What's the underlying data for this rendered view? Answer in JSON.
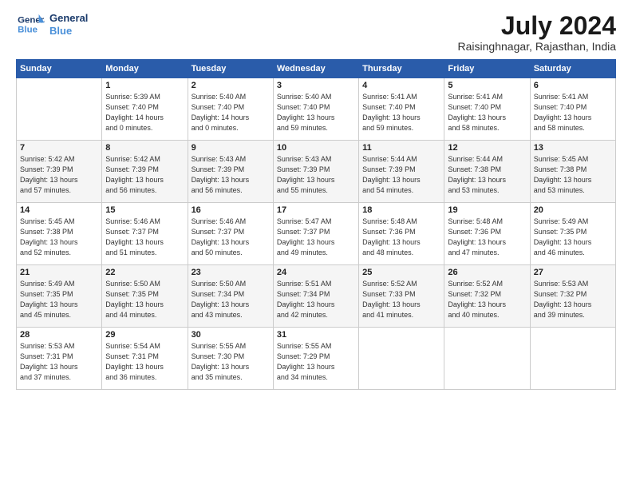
{
  "header": {
    "logo_line1": "General",
    "logo_line2": "Blue",
    "month_year": "July 2024",
    "location": "Raisinghnagar, Rajasthan, India"
  },
  "days_of_week": [
    "Sunday",
    "Monday",
    "Tuesday",
    "Wednesday",
    "Thursday",
    "Friday",
    "Saturday"
  ],
  "weeks": [
    [
      {
        "day": "",
        "info": ""
      },
      {
        "day": "1",
        "info": "Sunrise: 5:39 AM\nSunset: 7:40 PM\nDaylight: 14 hours\nand 0 minutes."
      },
      {
        "day": "2",
        "info": "Sunrise: 5:40 AM\nSunset: 7:40 PM\nDaylight: 14 hours\nand 0 minutes."
      },
      {
        "day": "3",
        "info": "Sunrise: 5:40 AM\nSunset: 7:40 PM\nDaylight: 13 hours\nand 59 minutes."
      },
      {
        "day": "4",
        "info": "Sunrise: 5:41 AM\nSunset: 7:40 PM\nDaylight: 13 hours\nand 59 minutes."
      },
      {
        "day": "5",
        "info": "Sunrise: 5:41 AM\nSunset: 7:40 PM\nDaylight: 13 hours\nand 58 minutes."
      },
      {
        "day": "6",
        "info": "Sunrise: 5:41 AM\nSunset: 7:40 PM\nDaylight: 13 hours\nand 58 minutes."
      }
    ],
    [
      {
        "day": "7",
        "info": "Sunrise: 5:42 AM\nSunset: 7:39 PM\nDaylight: 13 hours\nand 57 minutes."
      },
      {
        "day": "8",
        "info": "Sunrise: 5:42 AM\nSunset: 7:39 PM\nDaylight: 13 hours\nand 56 minutes."
      },
      {
        "day": "9",
        "info": "Sunrise: 5:43 AM\nSunset: 7:39 PM\nDaylight: 13 hours\nand 56 minutes."
      },
      {
        "day": "10",
        "info": "Sunrise: 5:43 AM\nSunset: 7:39 PM\nDaylight: 13 hours\nand 55 minutes."
      },
      {
        "day": "11",
        "info": "Sunrise: 5:44 AM\nSunset: 7:39 PM\nDaylight: 13 hours\nand 54 minutes."
      },
      {
        "day": "12",
        "info": "Sunrise: 5:44 AM\nSunset: 7:38 PM\nDaylight: 13 hours\nand 53 minutes."
      },
      {
        "day": "13",
        "info": "Sunrise: 5:45 AM\nSunset: 7:38 PM\nDaylight: 13 hours\nand 53 minutes."
      }
    ],
    [
      {
        "day": "14",
        "info": "Sunrise: 5:45 AM\nSunset: 7:38 PM\nDaylight: 13 hours\nand 52 minutes."
      },
      {
        "day": "15",
        "info": "Sunrise: 5:46 AM\nSunset: 7:37 PM\nDaylight: 13 hours\nand 51 minutes."
      },
      {
        "day": "16",
        "info": "Sunrise: 5:46 AM\nSunset: 7:37 PM\nDaylight: 13 hours\nand 50 minutes."
      },
      {
        "day": "17",
        "info": "Sunrise: 5:47 AM\nSunset: 7:37 PM\nDaylight: 13 hours\nand 49 minutes."
      },
      {
        "day": "18",
        "info": "Sunrise: 5:48 AM\nSunset: 7:36 PM\nDaylight: 13 hours\nand 48 minutes."
      },
      {
        "day": "19",
        "info": "Sunrise: 5:48 AM\nSunset: 7:36 PM\nDaylight: 13 hours\nand 47 minutes."
      },
      {
        "day": "20",
        "info": "Sunrise: 5:49 AM\nSunset: 7:35 PM\nDaylight: 13 hours\nand 46 minutes."
      }
    ],
    [
      {
        "day": "21",
        "info": "Sunrise: 5:49 AM\nSunset: 7:35 PM\nDaylight: 13 hours\nand 45 minutes."
      },
      {
        "day": "22",
        "info": "Sunrise: 5:50 AM\nSunset: 7:35 PM\nDaylight: 13 hours\nand 44 minutes."
      },
      {
        "day": "23",
        "info": "Sunrise: 5:50 AM\nSunset: 7:34 PM\nDaylight: 13 hours\nand 43 minutes."
      },
      {
        "day": "24",
        "info": "Sunrise: 5:51 AM\nSunset: 7:34 PM\nDaylight: 13 hours\nand 42 minutes."
      },
      {
        "day": "25",
        "info": "Sunrise: 5:52 AM\nSunset: 7:33 PM\nDaylight: 13 hours\nand 41 minutes."
      },
      {
        "day": "26",
        "info": "Sunrise: 5:52 AM\nSunset: 7:32 PM\nDaylight: 13 hours\nand 40 minutes."
      },
      {
        "day": "27",
        "info": "Sunrise: 5:53 AM\nSunset: 7:32 PM\nDaylight: 13 hours\nand 39 minutes."
      }
    ],
    [
      {
        "day": "28",
        "info": "Sunrise: 5:53 AM\nSunset: 7:31 PM\nDaylight: 13 hours\nand 37 minutes."
      },
      {
        "day": "29",
        "info": "Sunrise: 5:54 AM\nSunset: 7:31 PM\nDaylight: 13 hours\nand 36 minutes."
      },
      {
        "day": "30",
        "info": "Sunrise: 5:55 AM\nSunset: 7:30 PM\nDaylight: 13 hours\nand 35 minutes."
      },
      {
        "day": "31",
        "info": "Sunrise: 5:55 AM\nSunset: 7:29 PM\nDaylight: 13 hours\nand 34 minutes."
      },
      {
        "day": "",
        "info": ""
      },
      {
        "day": "",
        "info": ""
      },
      {
        "day": "",
        "info": ""
      }
    ]
  ]
}
